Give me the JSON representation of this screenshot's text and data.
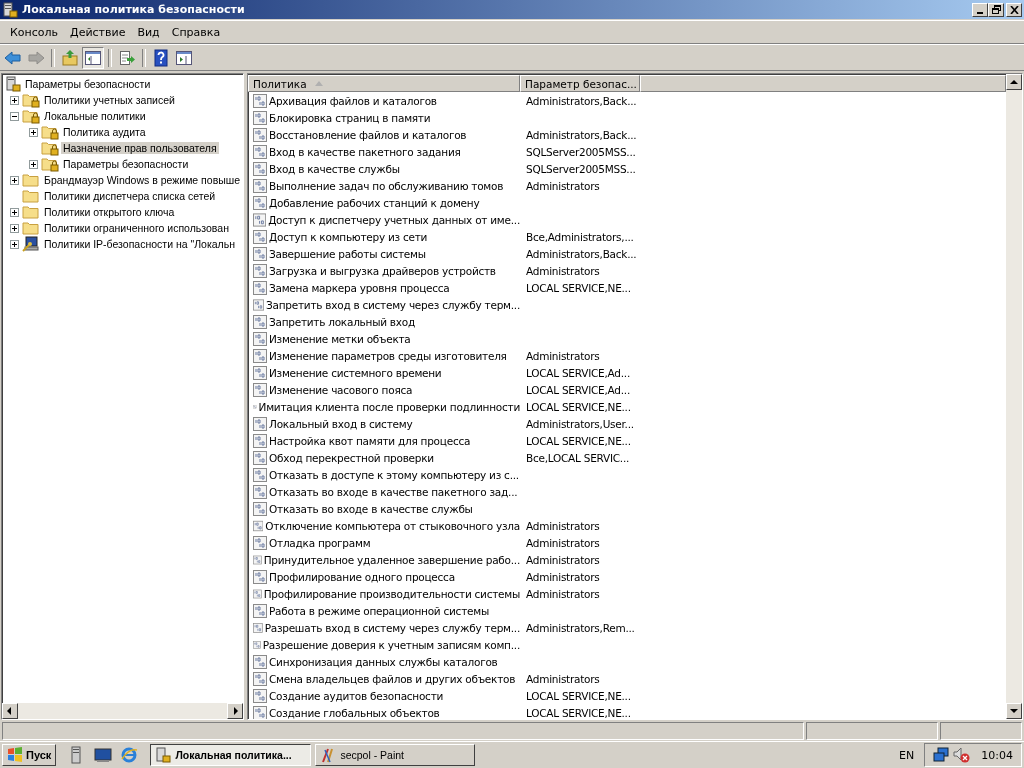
{
  "window": {
    "title": "Локальная политика безопасности"
  },
  "menu": [
    "Консоль",
    "Действие",
    "Вид",
    "Справка"
  ],
  "toolbar": [
    {
      "kind": "back",
      "disabled": false,
      "pressed": false
    },
    {
      "kind": "forward",
      "disabled": true,
      "pressed": false
    },
    {
      "kind": "up",
      "disabled": false,
      "pressed": false
    },
    {
      "kind": "tree",
      "disabled": false,
      "pressed": true
    },
    {
      "kind": "export",
      "disabled": false,
      "pressed": false
    },
    {
      "kind": "help",
      "disabled": false,
      "pressed": false
    },
    {
      "kind": "panel",
      "disabled": false,
      "pressed": false
    }
  ],
  "tree": [
    {
      "label": "Параметры безопасности",
      "kind": "root",
      "selected": false,
      "children": [
        {
          "label": "Политики учетных записей",
          "kind": "secure-folder",
          "expanded": false,
          "selected": false
        },
        {
          "label": "Локальные политики",
          "kind": "secure-folder",
          "expanded": true,
          "selected": false,
          "children": [
            {
              "label": "Политика аудита",
              "kind": "secure-folder",
              "expanded": false,
              "selected": false
            },
            {
              "label": "Назначение прав пользователя",
              "kind": "secure-folder",
              "selected": true
            },
            {
              "label": "Параметры безопасности",
              "kind": "secure-folder",
              "expanded": false,
              "selected": false
            }
          ]
        },
        {
          "label": "Брандмауэр Windows в режиме повыше",
          "kind": "folder",
          "expanded": false,
          "selected": false
        },
        {
          "label": "Политики диспетчера списка сетей",
          "kind": "folder",
          "selected": false
        },
        {
          "label": "Политики открытого ключа",
          "kind": "folder",
          "expanded": false,
          "selected": false
        },
        {
          "label": "Политики ограниченного использован",
          "kind": "folder",
          "expanded": false,
          "selected": false
        },
        {
          "label": "Политики IP-безопасности на \"Локальн",
          "kind": "ipsec",
          "expanded": false,
          "selected": false
        }
      ]
    }
  ],
  "table": {
    "columns": [
      "Политика",
      "Параметр безопас..."
    ],
    "rows": [
      {
        "policy": "Архивация файлов и каталогов",
        "setting": "Administrators,Back..."
      },
      {
        "policy": "Блокировка страниц в памяти"
      },
      {
        "policy": "Восстановление файлов и каталогов",
        "setting": "Administrators,Back..."
      },
      {
        "policy": "Вход в качестве пакетного задания",
        "setting": "SQLServer2005MSS..."
      },
      {
        "policy": "Вход в качестве службы",
        "setting": "SQLServer2005MSS..."
      },
      {
        "policy": "Выполнение задач по обслуживанию томов",
        "setting": "Administrators"
      },
      {
        "policy": "Добавление рабочих станций к домену"
      },
      {
        "policy": "Доступ к диспетчеру учетных данных от име..."
      },
      {
        "policy": "Доступ к компьютеру из сети",
        "setting": "Все,Administrators,..."
      },
      {
        "policy": "Завершение работы системы",
        "setting": "Administrators,Back..."
      },
      {
        "policy": "Загрузка и выгрузка драйверов устройств",
        "setting": "Administrators"
      },
      {
        "policy": "Замена маркера уровня процесса",
        "setting": "LOCAL SERVICE,NE..."
      },
      {
        "policy": "Запретить вход в систему через службу терм..."
      },
      {
        "policy": "Запретить локальный вход"
      },
      {
        "policy": "Изменение метки объекта"
      },
      {
        "policy": "Изменение параметров среды изготовителя",
        "setting": "Administrators"
      },
      {
        "policy": "Изменение системного времени",
        "setting": "LOCAL SERVICE,Ad..."
      },
      {
        "policy": "Изменение часового пояса",
        "setting": "LOCAL SERVICE,Ad..."
      },
      {
        "policy": "Имитация клиента после проверки подлинности",
        "setting": "LOCAL SERVICE,NE..."
      },
      {
        "policy": "Локальный вход в систему",
        "setting": "Administrators,User..."
      },
      {
        "policy": "Настройка квот памяти для процесса",
        "setting": "LOCAL SERVICE,NE..."
      },
      {
        "policy": "Обход перекрестной проверки",
        "setting": "Все,LOCAL SERVIC..."
      },
      {
        "policy": "Отказать в доступе к этому компьютеру из с..."
      },
      {
        "policy": "Отказать во входе в качестве пакетного зад..."
      },
      {
        "policy": "Отказать во входе в качестве службы"
      },
      {
        "policy": "Отключение компьютера от стыковочного узла",
        "setting": "Administrators"
      },
      {
        "policy": "Отладка программ",
        "setting": "Administrators"
      },
      {
        "policy": "Принудительное удаленное завершение рабо...",
        "setting": "Administrators"
      },
      {
        "policy": "Профилирование одного процесса",
        "setting": "Administrators"
      },
      {
        "policy": "Профилирование производительности системы",
        "setting": "Administrators"
      },
      {
        "policy": "Работа в режиме операционной системы"
      },
      {
        "policy": "Разрешать вход в систему через службу терм...",
        "setting": "Administrators,Rem..."
      },
      {
        "policy": "Разрешение доверия к учетным записям комп..."
      },
      {
        "policy": "Синхронизация данных службы каталогов"
      },
      {
        "policy": "Смена владельцев файлов и других объектов",
        "setting": "Administrators"
      },
      {
        "policy": "Создание аудитов безопасности",
        "setting": "LOCAL SERVICE,NE..."
      },
      {
        "policy": "Создание глобальных объектов",
        "setting": "LOCAL SERVICE,NE..."
      }
    ]
  },
  "taskbar": {
    "start": "Пуск",
    "tasks": [
      {
        "label": "Локальная политика...",
        "kind": "secpol",
        "selected": true
      },
      {
        "label": "secpol - Paint",
        "kind": "paint",
        "selected": false
      }
    ],
    "language": "EN",
    "clock": "10:04"
  }
}
